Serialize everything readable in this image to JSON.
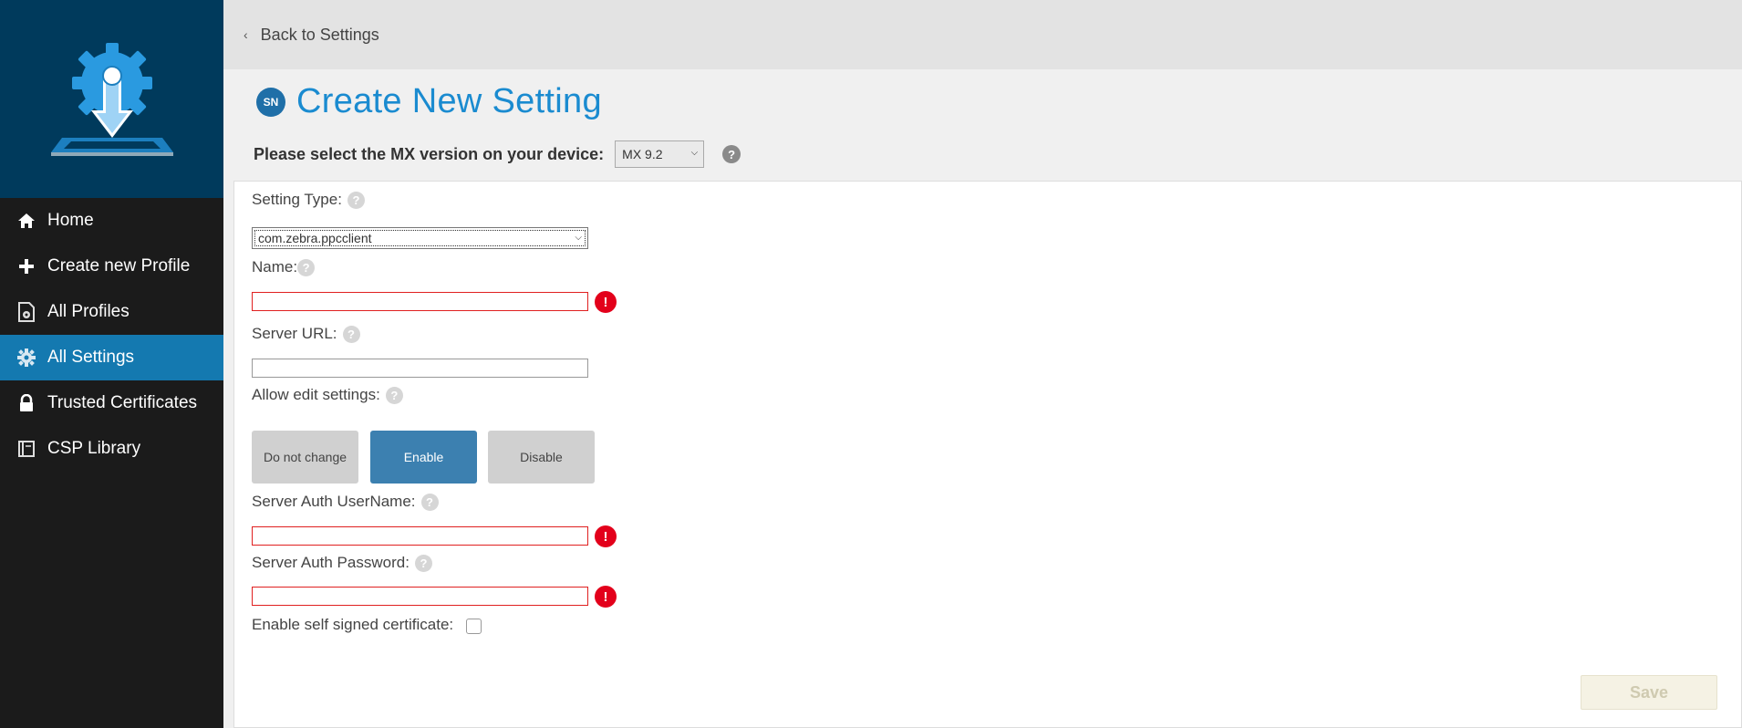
{
  "sidebar": {
    "items": [
      {
        "label": "Home",
        "icon": "home-icon",
        "active": false
      },
      {
        "label": "Create new Profile",
        "icon": "plus-icon",
        "active": false
      },
      {
        "label": "All Profiles",
        "icon": "profiles-icon",
        "active": false
      },
      {
        "label": "All Settings",
        "icon": "gear-icon",
        "active": true
      },
      {
        "label": "Trusted Certificates",
        "icon": "lock-icon",
        "active": false
      },
      {
        "label": "CSP Library",
        "icon": "book-icon",
        "active": false
      }
    ]
  },
  "topbar": {
    "back_label": "Back to Settings"
  },
  "header": {
    "badge": "SN",
    "title": "Create New Setting",
    "mx_label": "Please select the MX version on your device:",
    "mx_value": "MX 9.2"
  },
  "form": {
    "setting_type_label": "Setting Type:",
    "setting_type_value": "com.zebra.ppcclient",
    "name_label": "Name:",
    "server_url_label": "Server URL:",
    "allow_edit_label": "Allow edit settings:",
    "options": [
      "Do not change",
      "Enable",
      "Disable"
    ],
    "selected_option": "Enable",
    "username_label": "Server Auth UserName:",
    "password_label": "Server Auth Password:",
    "self_signed_label": "Enable self signed certificate:",
    "help_glyph": "?",
    "error_glyph": "!",
    "save_label": "Save"
  },
  "colors": {
    "sidebar_bg": "#1b1b1b",
    "logo_bg": "#003a5c",
    "active_nav": "#1479b0",
    "title_blue": "#1a8bd0",
    "enable_button": "#3c80b0",
    "error_red": "#e3001b"
  }
}
